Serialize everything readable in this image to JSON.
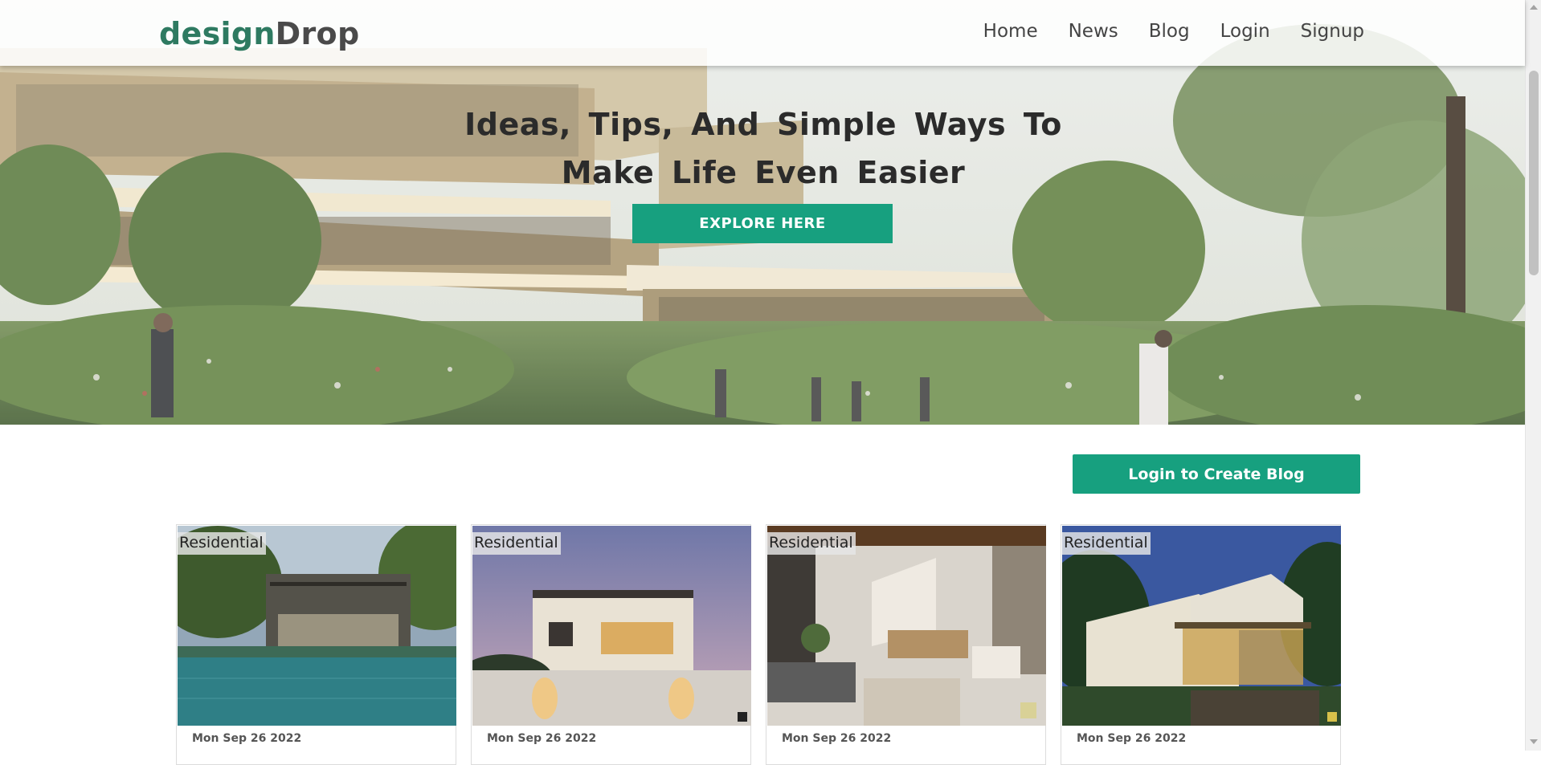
{
  "brand": {
    "part1": "design",
    "part2": "Drop"
  },
  "nav": {
    "home": "Home",
    "news": "News",
    "blog": "Blog",
    "login": "Login",
    "signup": "Signup"
  },
  "hero": {
    "line1": "Ideas, Tips, And Simple Ways To",
    "line2": "Make Life Even Easier",
    "button": "EXPLORE  HERE"
  },
  "create_blog_button": "Login to Create Blog",
  "colors": {
    "accent": "#17a07f",
    "brand_green": "#2e7a61",
    "text_dark": "#2b2b2b"
  },
  "cards": [
    {
      "category": "Residential",
      "date": "Mon Sep 26 2022",
      "image": "house-pool-photo"
    },
    {
      "category": "Residential",
      "date": "Mon Sep 26 2022",
      "image": "villa-dusk-photo"
    },
    {
      "category": "Residential",
      "date": "Mon Sep 26 2022",
      "image": "living-room-photo"
    },
    {
      "category": "Residential",
      "date": "Mon Sep 26 2022",
      "image": "house-garden-photo"
    }
  ]
}
